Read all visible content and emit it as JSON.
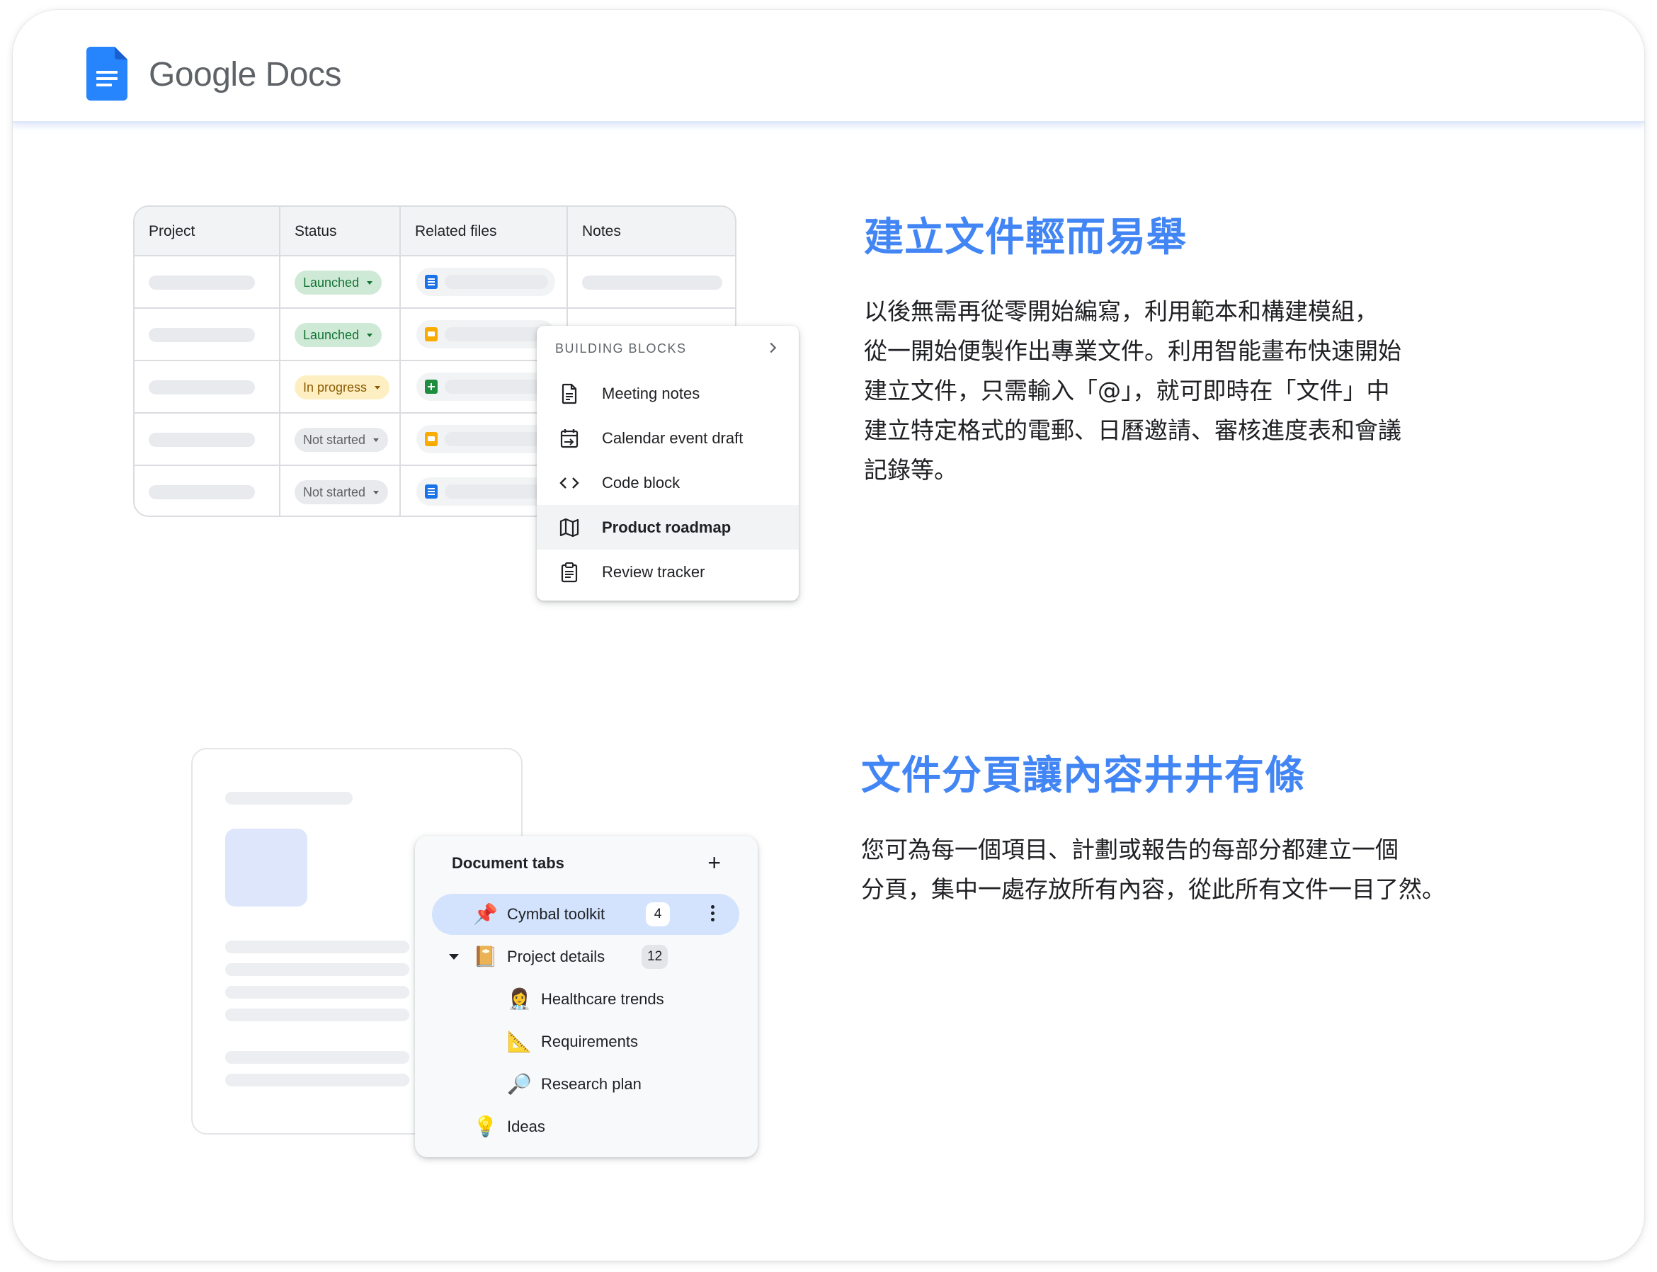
{
  "app": {
    "brand": "Google Docs"
  },
  "table": {
    "headers": [
      "Project",
      "Status",
      "Related files",
      "Notes"
    ],
    "rows": [
      {
        "status": "Launched",
        "file_icon": "docs-icon"
      },
      {
        "status": "Launched",
        "file_icon": "slides-icon"
      },
      {
        "status": "In progress",
        "file_icon": "sheets-icon"
      },
      {
        "status": "Not started",
        "file_icon": "slides-icon"
      },
      {
        "status": "Not started",
        "file_icon": "docs-icon"
      }
    ]
  },
  "menu": {
    "header": "BUILDING BLOCKS",
    "items": [
      {
        "label": "Meeting notes",
        "icon": "document-icon"
      },
      {
        "label": "Calendar event draft",
        "icon": "calendar-icon"
      },
      {
        "label": "Code block",
        "icon": "code-icon"
      },
      {
        "label": "Product roadmap",
        "icon": "map-icon",
        "selected": true
      },
      {
        "label": "Review tracker",
        "icon": "clipboard-icon"
      }
    ]
  },
  "section1": {
    "heading": "建立文件輕而易舉",
    "lines": [
      "以後無需再從零開始編寫，利用範本和構建模組，",
      "從一開始便製作出專業文件。利用智能畫布快速開始",
      "建立文件，只需輸入「@」，就可即時在「文件」中",
      "建立特定格式的電郵、日曆邀請、審核進度表和會議",
      "記錄等。"
    ]
  },
  "section2": {
    "heading": "文件分頁讓內容井井有條",
    "lines": [
      "您可為每一個項目、計劃或報告的每部分都建立一個",
      "分頁，集中一處存放所有內容，從此所有文件一目了然。"
    ]
  },
  "tabs_panel": {
    "title": "Document tabs",
    "add_symbol": "+",
    "items": [
      {
        "emoji": "📌",
        "label": "Cymbal toolkit",
        "count": "4",
        "active": true
      },
      {
        "emoji": "📔",
        "label": "Project details",
        "count": "12",
        "expanded": true
      },
      {
        "emoji": "👩‍⚕️",
        "label": "Healthcare trends"
      },
      {
        "emoji": "📐",
        "label": "Requirements"
      },
      {
        "emoji": "🔎",
        "label": "Research plan"
      },
      {
        "emoji": "💡",
        "label": "Ideas"
      }
    ]
  },
  "colors": {
    "accent": "#4285f4",
    "launched_bg": "#ceead6",
    "in_progress_bg": "#feefc3",
    "not_started_bg": "#e8eaed",
    "active_tab_bg": "#d3e3fd"
  }
}
